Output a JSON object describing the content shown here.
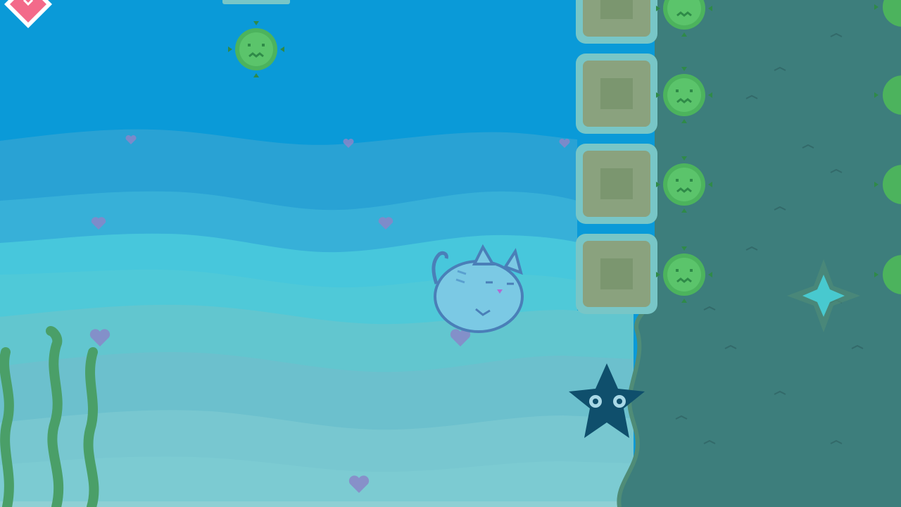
{
  "scene": {
    "type": "underwater platformer",
    "colors": {
      "sky_top": "#0a9ad8",
      "wave_1": "#29a2d4",
      "wave_2": "#3cb3d8",
      "wave_3": "#47c7dc",
      "wave_4": "#4fc9d8",
      "sand_1": "#67c7cd",
      "sand_2": "#6cc0cd",
      "sand_3": "#78c7d0",
      "rock": "#3d7e7c",
      "rock_dark": "#366f6f",
      "rock_edge": "#4f8c77",
      "block_fill": "#8aa27e",
      "block_border": "#78c6c7",
      "pufferfish": "#4cb35d",
      "pufferfish_dark": "#2f8a48",
      "seaweed": "#4a9f68",
      "heart": "#8a86c8",
      "cat_body": "#7bc9e4",
      "cat_outline": "#4a7fb8",
      "starfish": "#0f4f6c",
      "star_glow": "#48c9cf",
      "life_badge": "#f36a8a"
    }
  },
  "hud": {
    "life_icon": "heart-badge-icon"
  },
  "player": {
    "character": "cat"
  },
  "enemies": [
    {
      "kind": "pufferfish"
    },
    {
      "kind": "pufferfish"
    },
    {
      "kind": "pufferfish"
    },
    {
      "kind": "pufferfish"
    },
    {
      "kind": "pufferfish"
    },
    {
      "kind": "pufferfish"
    },
    {
      "kind": "pufferfish"
    },
    {
      "kind": "pufferfish"
    },
    {
      "kind": "pufferfish"
    },
    {
      "kind": "starfish"
    }
  ],
  "collectibles": [
    {
      "kind": "star"
    }
  ],
  "terrain": {
    "block_count": 4,
    "seaweed_count": 3,
    "heart_count": 9
  }
}
